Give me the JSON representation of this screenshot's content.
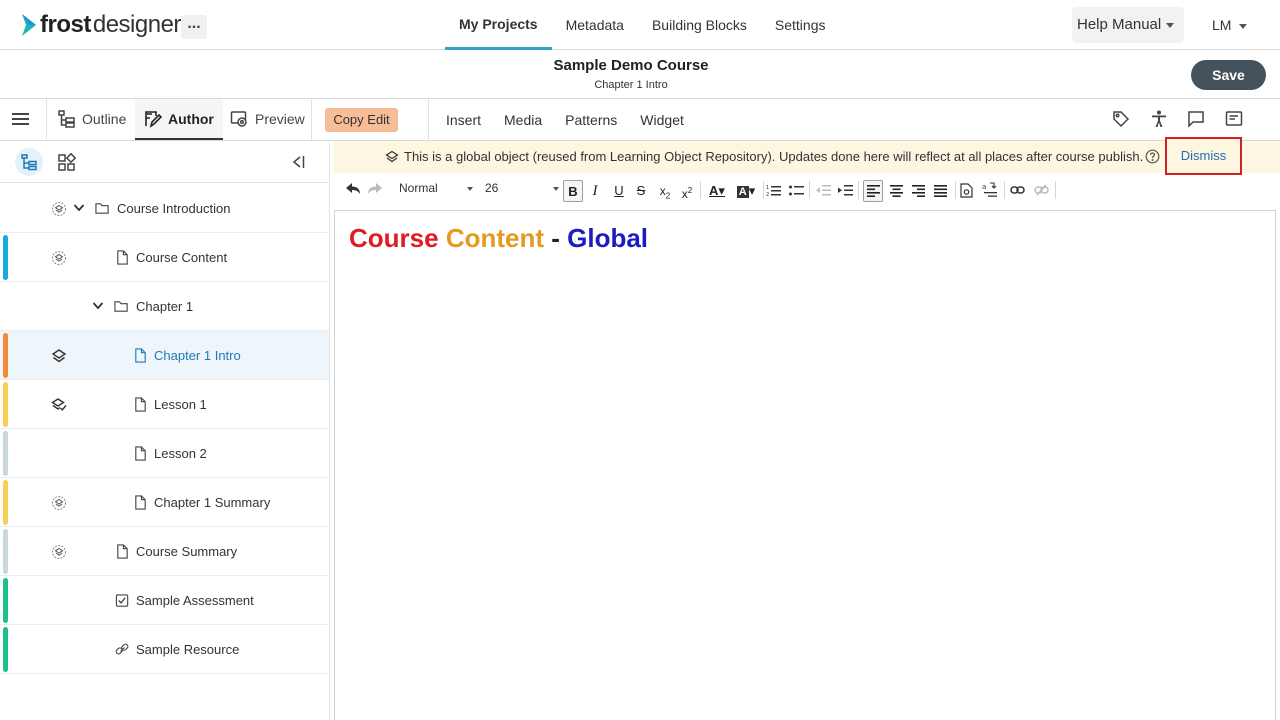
{
  "app": {
    "logo_bold": "frost",
    "logo_rest": "designer",
    "more_label": "...",
    "nav_tabs": [
      {
        "label": "My Projects",
        "active": true
      },
      {
        "label": "Metadata",
        "active": false
      },
      {
        "label": "Building Blocks",
        "active": false
      },
      {
        "label": "Settings",
        "active": false
      }
    ],
    "help_label": "Help Manual",
    "user_initials": "LM"
  },
  "course": {
    "title": "Sample Demo Course",
    "subtitle": "Chapter 1 Intro",
    "save_label": "Save"
  },
  "modes": {
    "outline": "Outline",
    "author": "Author",
    "preview": "Preview",
    "copy_edit": "Copy Edit",
    "menu": [
      "Insert",
      "Media",
      "Patterns",
      "Widget"
    ]
  },
  "tree": [
    {
      "label": "Course Introduction",
      "bar": "",
      "badge": "global",
      "chevron": true,
      "icon": "folder"
    },
    {
      "label": "Course Content",
      "bar": "#19a9e1",
      "badge": "global",
      "chevron": false,
      "icon": "page"
    },
    {
      "label": "Chapter 1",
      "bar": "",
      "badge": "",
      "chevron": true,
      "icon": "folder"
    },
    {
      "label": "Chapter 1 Intro",
      "bar": "#f4893e",
      "badge": "layers",
      "chevron": false,
      "icon": "page",
      "active": true
    },
    {
      "label": "Lesson 1",
      "bar": "#f7cf52",
      "badge": "layers-check",
      "chevron": false,
      "icon": "page"
    },
    {
      "label": "Lesson 2",
      "bar": "#c9d8dc",
      "badge": "",
      "chevron": false,
      "icon": "page"
    },
    {
      "label": "Chapter 1 Summary",
      "bar": "#f7cf52",
      "badge": "global",
      "chevron": false,
      "icon": "page"
    },
    {
      "label": "Course Summary",
      "bar": "#c9d8dc",
      "badge": "global",
      "chevron": false,
      "icon": "page"
    },
    {
      "label": "Sample Assessment",
      "bar": "#1cbf8e",
      "badge": "",
      "chevron": false,
      "icon": "check-square"
    },
    {
      "label": "Sample Resource",
      "bar": "#1cbf8e",
      "badge": "",
      "chevron": false,
      "icon": "link"
    }
  ],
  "banner": {
    "text": "This is a global object (reused from Learning Object Repository). Updates done here will reflect at all places after course publish.",
    "dismiss_label": "Dismiss"
  },
  "toolbar": {
    "style_value": "Normal",
    "size_value": "26"
  },
  "editor": {
    "word1": "Course",
    "word2": "Content",
    "word3": "- ",
    "word4": "Global",
    "colors": {
      "word1": "#e01b24",
      "word2": "#e39a21",
      "word3": "#222222",
      "word4": "#1b1bc4"
    }
  },
  "colors": {
    "accent": "#2ea3c6",
    "save_bg": "#45525c",
    "copyedit_bg": "#f6bd96",
    "banner_bg": "#fdf6e0",
    "dismiss_border": "#d11f28"
  }
}
